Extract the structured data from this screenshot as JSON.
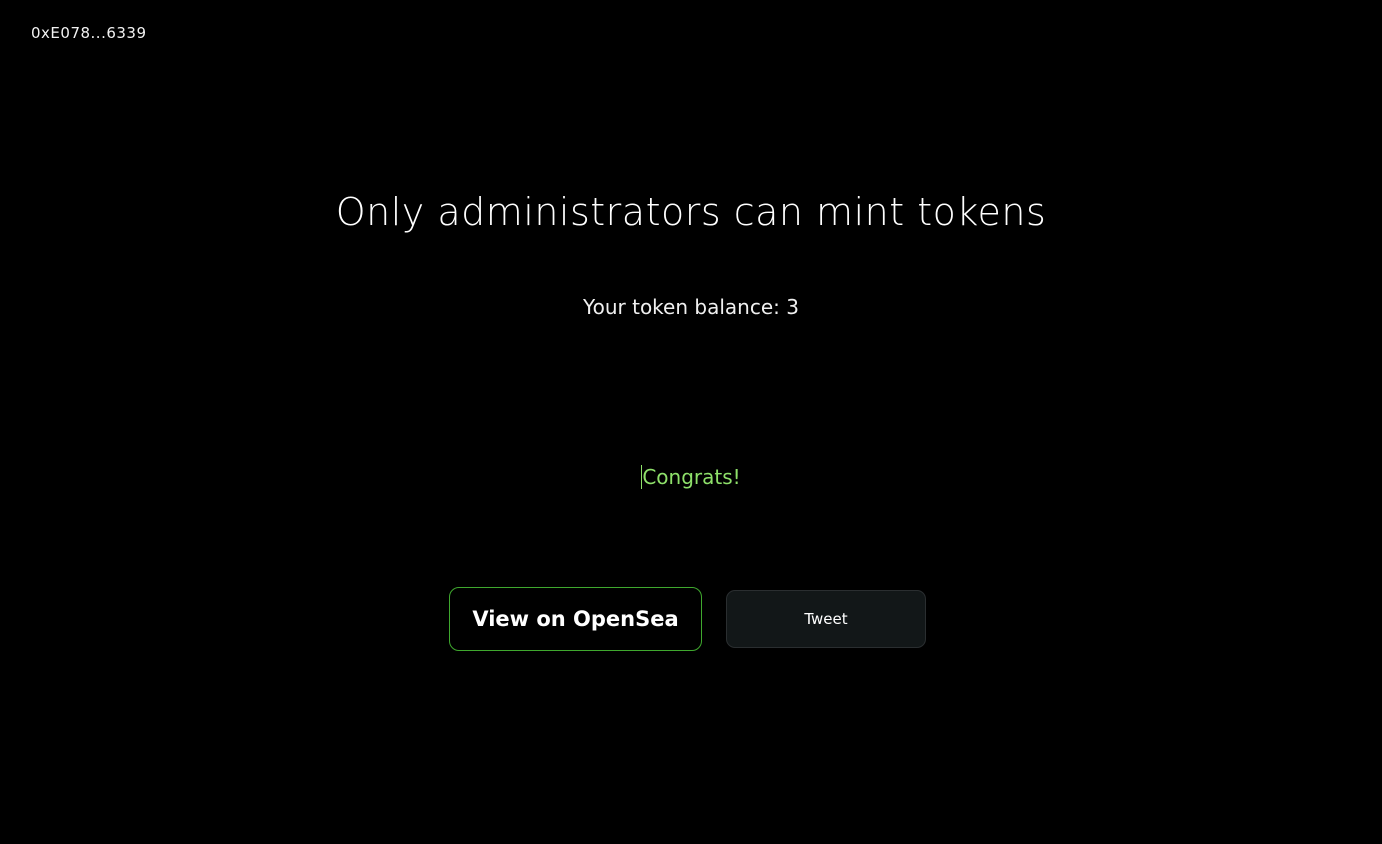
{
  "header": {
    "wallet_address": "0xE078...6339"
  },
  "main": {
    "title": "Only administrators can mint tokens",
    "balance_text": "Your token balance: 3",
    "status_text": "Congrats!"
  },
  "actions": {
    "opensea_label": "View on OpenSea",
    "tweet_label": "Tweet"
  },
  "colors": {
    "background": "#000000",
    "text": "#ffffff",
    "success": "#8ee06a",
    "opensea_border": "#3fa82e",
    "tweet_bg": "#121718"
  }
}
